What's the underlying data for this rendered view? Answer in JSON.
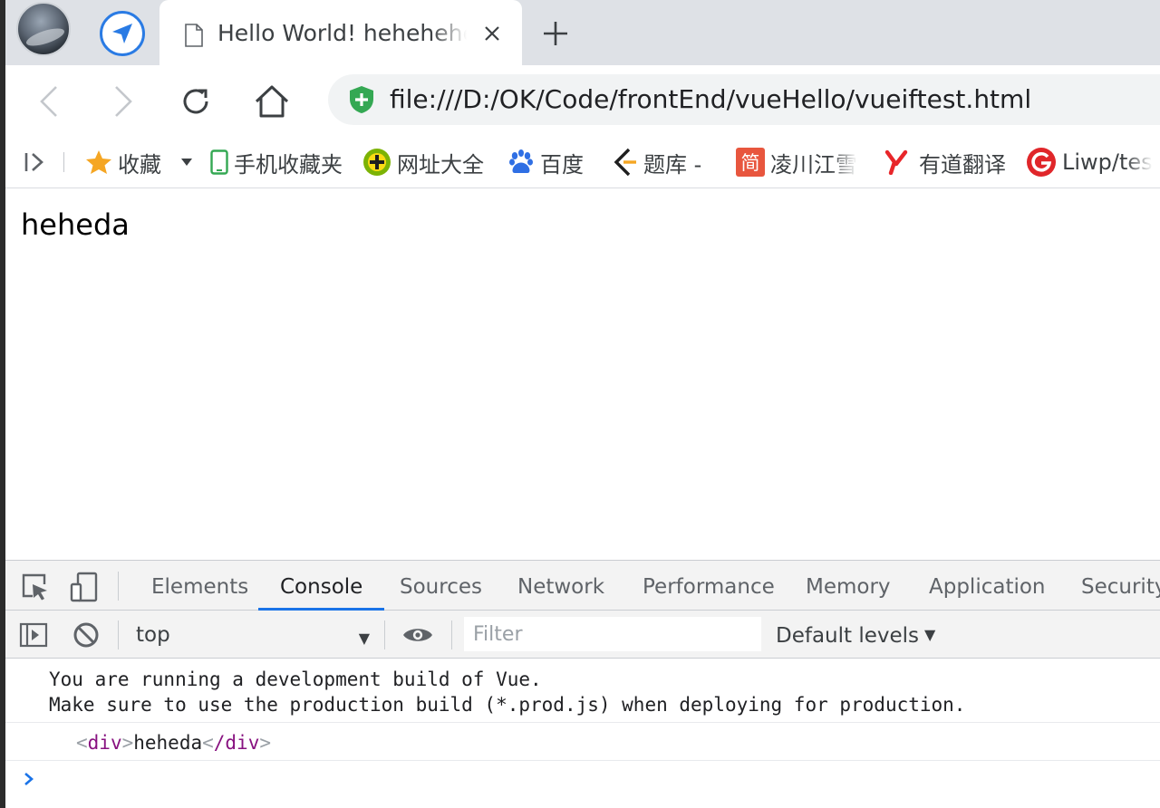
{
  "browser": {
    "tab": {
      "title": "Hello World! hehehehehe"
    },
    "address": {
      "url": "file:///D:/OK/Code/frontEnd/vueHello/vueiftest.html"
    },
    "bookmarks": [
      {
        "label": "收藏",
        "icon": "star-icon"
      },
      {
        "label": "手机收藏夹",
        "icon": "phone-icon"
      },
      {
        "label": "网址大全",
        "icon": "site-directory-icon"
      },
      {
        "label": "百度",
        "icon": "baidu-paw-icon"
      },
      {
        "label": "题库 -",
        "icon": "question-bank-icon"
      },
      {
        "label": "凌川江雪",
        "icon": "jian-icon"
      },
      {
        "label": "有道翻译",
        "icon": "youdao-icon"
      },
      {
        "label": "Liwp/tes",
        "icon": "gitee-icon"
      }
    ],
    "bookmark_jian_char": "简"
  },
  "page": {
    "text": "heheda"
  },
  "devtools": {
    "tabs": [
      "Elements",
      "Console",
      "Sources",
      "Network",
      "Performance",
      "Memory",
      "Application",
      "Security"
    ],
    "active_tab": "Console",
    "console": {
      "context": "top",
      "filter_placeholder": "Filter",
      "levels": "Default levels",
      "messages": [
        "You are running a development build of Vue.\nMake sure to use the production build (*.prod.js) when deploying for production."
      ],
      "log": {
        "open_tag": "div",
        "text": "heheda",
        "close_tag": "/div"
      }
    }
  },
  "colors": {
    "accent": "#1a73e8",
    "tabstrip": "#dee1e6",
    "shield": "#34a853",
    "tag": "#881280"
  }
}
